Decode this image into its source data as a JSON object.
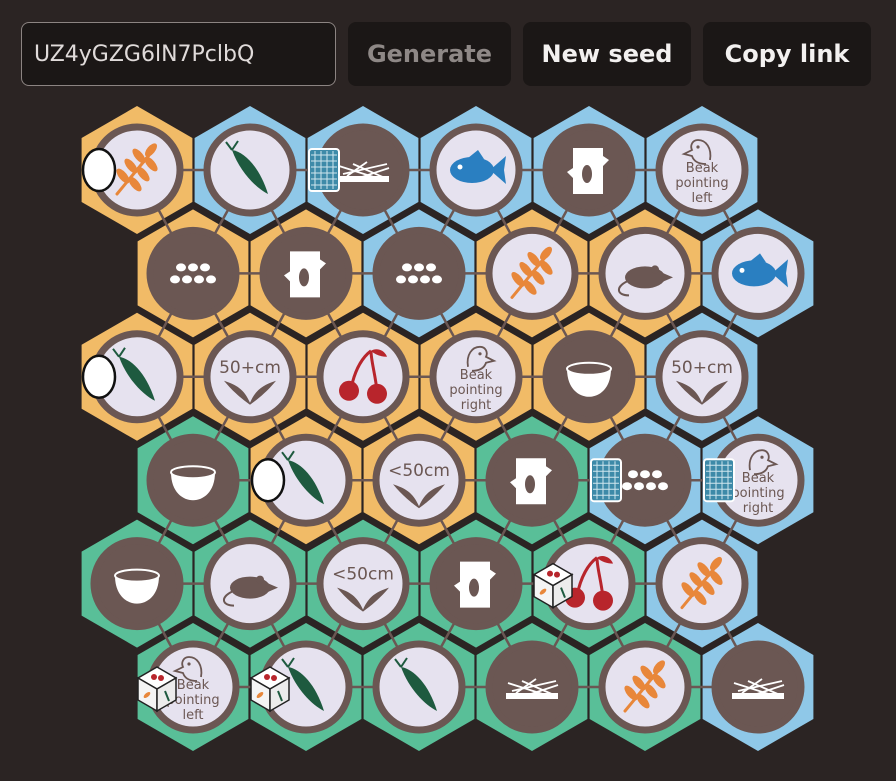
{
  "toolbar": {
    "seed_value": "UZ4yGZG6lN7PclbQ",
    "generate_label": "Generate",
    "new_seed_label": "New seed",
    "copy_link_label": "Copy link"
  },
  "colors": {
    "page_bg": "#2b2423",
    "terrain_yellow": "#f1bb67",
    "terrain_blue": "#8fc8e8",
    "terrain_green": "#59bf98",
    "tile_light": "#e6e2ef",
    "tile_dark": "#6b5753",
    "tile_ring": "#6b5753",
    "grain": "#e8873a",
    "fish": "#2a7fc1",
    "cherry": "#b8252c",
    "slug": "#1e5a3f"
  },
  "board": {
    "rows": [
      [
        {
          "terrain": "yellow",
          "style": "light",
          "icon": "grain-icon",
          "token": "egg"
        },
        {
          "terrain": "blue",
          "style": "light",
          "icon": "slug-icon"
        },
        {
          "terrain": "blue",
          "style": "dark",
          "icon": "nest-icon",
          "token": "card"
        },
        {
          "terrain": "blue",
          "style": "light",
          "icon": "fish-icon"
        },
        {
          "terrain": "blue",
          "style": "dark",
          "icon": "stump-icon"
        },
        {
          "terrain": "blue",
          "style": "light",
          "icon": "beak-left-icon",
          "lines": [
            "Beak",
            "pointing",
            "left"
          ]
        }
      ],
      [
        {
          "terrain": "yellow",
          "style": "dark",
          "icon": "eggs-icon"
        },
        {
          "terrain": "yellow",
          "style": "dark",
          "icon": "stump-icon"
        },
        {
          "terrain": "blue",
          "style": "dark",
          "icon": "eggs-icon"
        },
        {
          "terrain": "yellow",
          "style": "light",
          "icon": "grain-icon"
        },
        {
          "terrain": "yellow",
          "style": "light",
          "icon": "rodent-icon"
        },
        {
          "terrain": "blue",
          "style": "light",
          "icon": "fish-icon"
        }
      ],
      [
        {
          "terrain": "yellow",
          "style": "light",
          "icon": "slug-icon",
          "token": "egg"
        },
        {
          "terrain": "yellow",
          "style": "light",
          "icon": "wingspan-icon",
          "label": "50+cm"
        },
        {
          "terrain": "yellow",
          "style": "light",
          "icon": "cherry-icon"
        },
        {
          "terrain": "yellow",
          "style": "light",
          "icon": "beak-right-icon",
          "lines": [
            "Beak",
            "pointing",
            "right"
          ]
        },
        {
          "terrain": "yellow",
          "style": "dark",
          "icon": "bowl-icon"
        },
        {
          "terrain": "blue",
          "style": "light",
          "icon": "wingspan-icon",
          "label": "50+cm"
        }
      ],
      [
        {
          "terrain": "green",
          "style": "dark",
          "icon": "bowl-icon"
        },
        {
          "terrain": "yellow",
          "style": "light",
          "icon": "slug-icon",
          "token": "egg"
        },
        {
          "terrain": "yellow",
          "style": "light",
          "icon": "wingspan-icon",
          "label": "<50cm"
        },
        {
          "terrain": "green",
          "style": "dark",
          "icon": "stump-icon"
        },
        {
          "terrain": "blue",
          "style": "dark",
          "icon": "eggs-icon",
          "token": "card"
        },
        {
          "terrain": "blue",
          "style": "light",
          "icon": "beak-right-icon",
          "lines": [
            "Beak",
            "pointing",
            "right"
          ],
          "token": "card"
        }
      ],
      [
        {
          "terrain": "green",
          "style": "dark",
          "icon": "bowl-icon"
        },
        {
          "terrain": "green",
          "style": "light",
          "icon": "rodent-icon"
        },
        {
          "terrain": "green",
          "style": "light",
          "icon": "wingspan-icon",
          "label": "<50cm"
        },
        {
          "terrain": "green",
          "style": "dark",
          "icon": "stump-icon"
        },
        {
          "terrain": "green",
          "style": "light",
          "icon": "cherry-icon",
          "token": "die"
        },
        {
          "terrain": "blue",
          "style": "light",
          "icon": "grain-icon"
        }
      ],
      [
        {
          "terrain": "green",
          "style": "light",
          "icon": "beak-left-icon",
          "lines": [
            "Beak",
            "pointing",
            "left"
          ],
          "token": "die"
        },
        {
          "terrain": "green",
          "style": "light",
          "icon": "slug-icon",
          "token": "die"
        },
        {
          "terrain": "green",
          "style": "light",
          "icon": "slug-icon"
        },
        {
          "terrain": "green",
          "style": "dark",
          "icon": "nest-icon"
        },
        {
          "terrain": "green",
          "style": "light",
          "icon": "grain-icon"
        },
        {
          "terrain": "blue",
          "style": "dark",
          "icon": "nest-icon"
        }
      ]
    ]
  }
}
